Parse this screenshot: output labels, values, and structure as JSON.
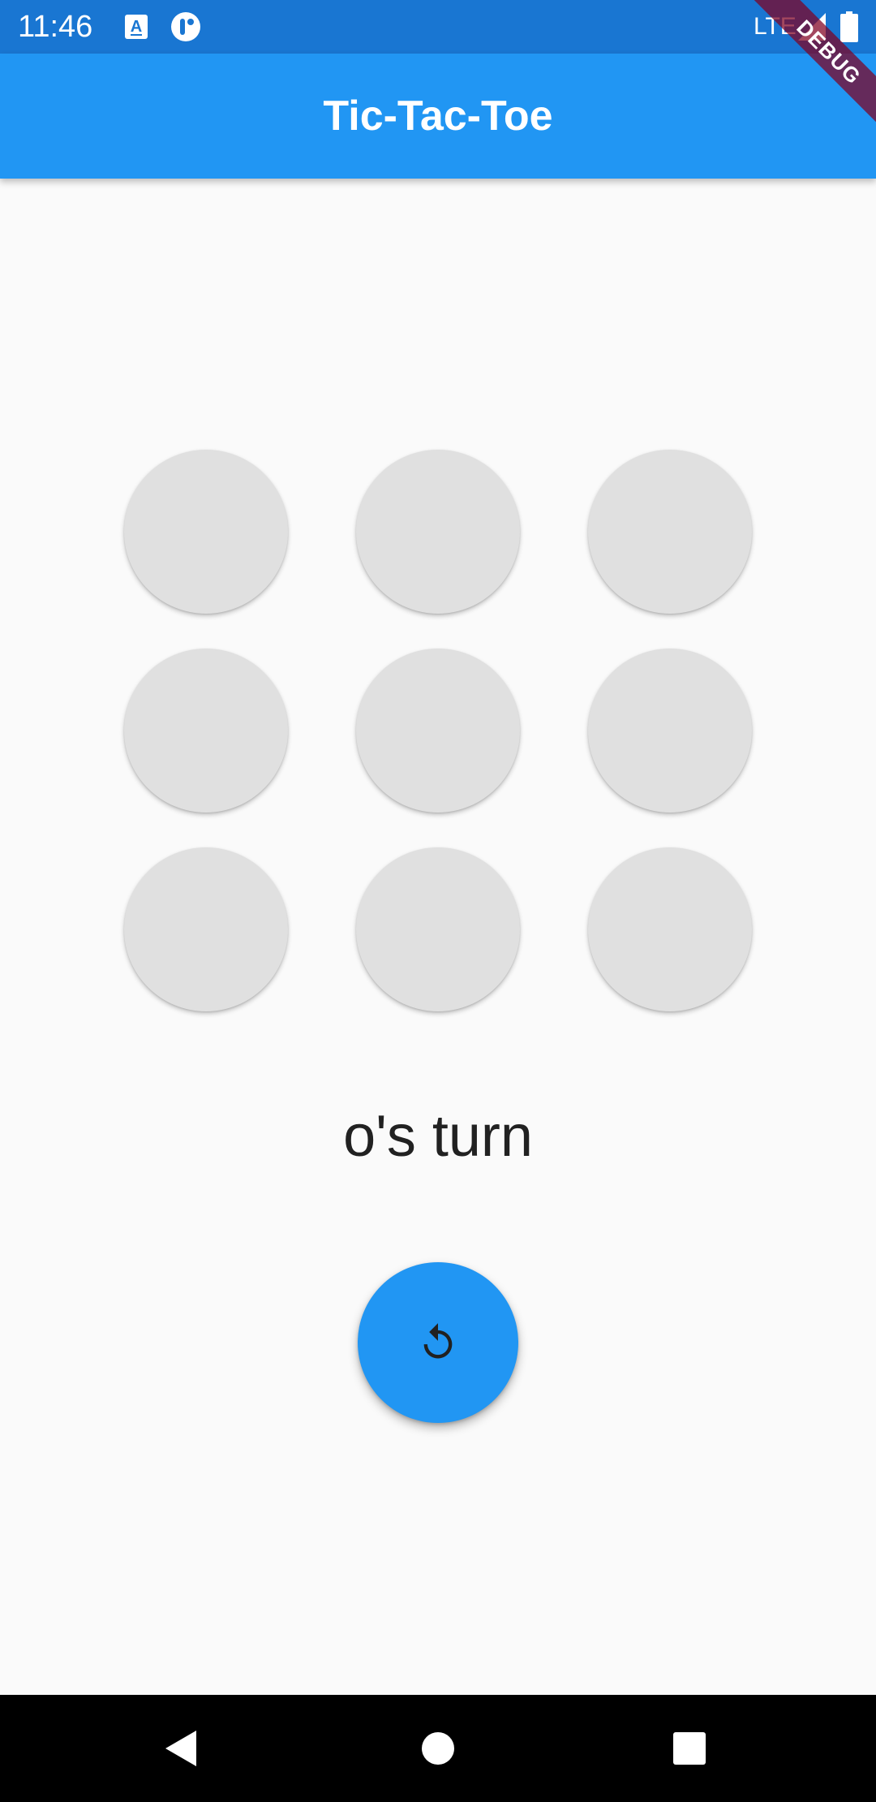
{
  "status_bar": {
    "time": "11:46",
    "network": "LTE",
    "icons": [
      "font-icon",
      "app-notification-icon",
      "signal-icon",
      "battery-icon"
    ]
  },
  "app_bar": {
    "title": "Tic-Tac-Toe",
    "debug_label": "DEBUG"
  },
  "board": {
    "cells": [
      "",
      "",
      "",
      "",
      "",
      "",
      "",
      "",
      ""
    ]
  },
  "status": {
    "turn_text": "o's turn"
  },
  "reset_button": {
    "icon": "replay-icon"
  },
  "nav_bar": {
    "buttons": [
      "back-icon",
      "home-icon",
      "recents-icon"
    ]
  },
  "colors": {
    "status_bar": "#1976d2",
    "app_bar": "#2196f3",
    "background": "#fafafa",
    "cell": "#e0e0e0",
    "fab": "#2196f3",
    "debug_banner": "#800020"
  }
}
